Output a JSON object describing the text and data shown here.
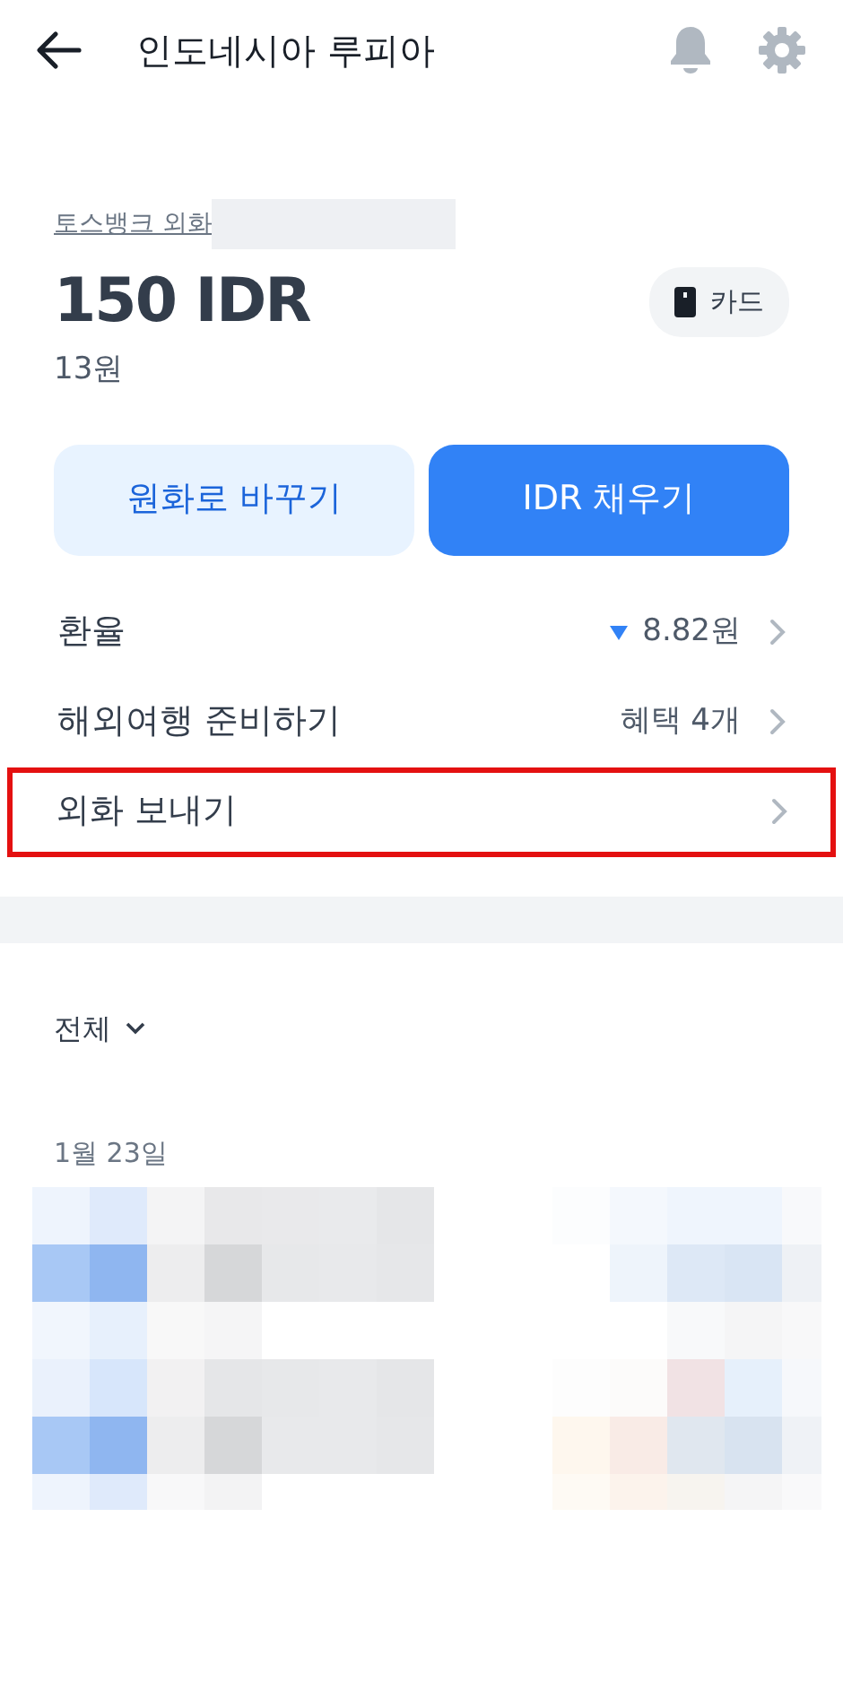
{
  "header": {
    "title": "인도네시아 루피아"
  },
  "account": {
    "label": "토스뱅크 외화",
    "balance": "150 IDR",
    "krw": "13원",
    "card_button": "카드"
  },
  "buttons": [
    {
      "label": "원화로 바꾸기",
      "kind": "secondary"
    },
    {
      "label": "IDR 채우기",
      "kind": "primary"
    }
  ],
  "menu": [
    {
      "label": "환율",
      "value": "8.82원",
      "falling": true,
      "highlighted": false
    },
    {
      "label": "해외여행 준비하기",
      "value": "혜택 4개",
      "highlighted": false
    },
    {
      "label": "외화 보내기",
      "highlighted": true
    }
  ],
  "filter": {
    "label": "전체"
  },
  "history": {
    "date": "1월 23일"
  }
}
